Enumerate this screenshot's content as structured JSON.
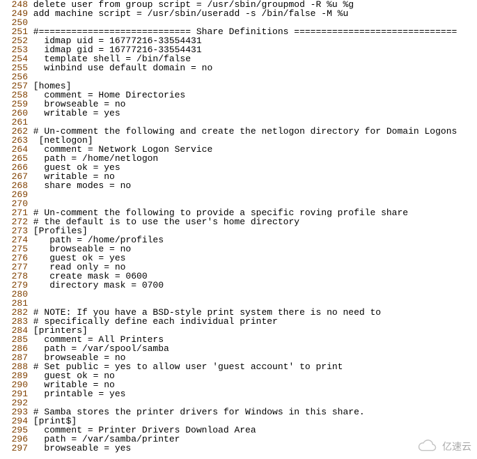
{
  "watermark": "亿速云",
  "lines": [
    {
      "n": 248,
      "t": " delete user from group script = /usr/sbin/groupmod -R %u %g"
    },
    {
      "n": 249,
      "t": " add machine script = /usr/sbin/useradd -s /bin/false -M %u"
    },
    {
      "n": 250,
      "t": ""
    },
    {
      "n": 251,
      "t": " #============================ Share Definitions =============================="
    },
    {
      "n": 252,
      "t": "   idmap uid = 16777216-33554431"
    },
    {
      "n": 253,
      "t": "   idmap gid = 16777216-33554431"
    },
    {
      "n": 254,
      "t": "   template shell = /bin/false"
    },
    {
      "n": 255,
      "t": "   winbind use default domain = no"
    },
    {
      "n": 256,
      "t": ""
    },
    {
      "n": 257,
      "t": " [homes]"
    },
    {
      "n": 258,
      "t": "   comment = Home Directories"
    },
    {
      "n": 259,
      "t": "   browseable = no"
    },
    {
      "n": 260,
      "t": "   writable = yes"
    },
    {
      "n": 261,
      "t": ""
    },
    {
      "n": 262,
      "t": " # Un-comment the following and create the netlogon directory for Domain Logons"
    },
    {
      "n": 263,
      "t": "  [netlogon]"
    },
    {
      "n": 264,
      "t": "   comment = Network Logon Service"
    },
    {
      "n": 265,
      "t": "   path = /home/netlogon"
    },
    {
      "n": 266,
      "t": "   guest ok = yes"
    },
    {
      "n": 267,
      "t": "   writable = no"
    },
    {
      "n": 268,
      "t": "   share modes = no"
    },
    {
      "n": 269,
      "t": ""
    },
    {
      "n": 270,
      "t": ""
    },
    {
      "n": 271,
      "t": " # Un-comment the following to provide a specific roving profile share"
    },
    {
      "n": 272,
      "t": " # the default is to use the user's home directory"
    },
    {
      "n": 273,
      "t": " [Profiles]"
    },
    {
      "n": 274,
      "t": "    path = /home/profiles"
    },
    {
      "n": 275,
      "t": "    browseable = no"
    },
    {
      "n": 276,
      "t": "    guest ok = yes"
    },
    {
      "n": 277,
      "t": "    read only = no"
    },
    {
      "n": 278,
      "t": "    create mask = 0600"
    },
    {
      "n": 279,
      "t": "    directory mask = 0700"
    },
    {
      "n": 280,
      "t": ""
    },
    {
      "n": 281,
      "t": ""
    },
    {
      "n": 282,
      "t": " # NOTE: If you have a BSD-style print system there is no need to"
    },
    {
      "n": 283,
      "t": " # specifically define each individual printer"
    },
    {
      "n": 284,
      "t": " [printers]"
    },
    {
      "n": 285,
      "t": "   comment = All Printers"
    },
    {
      "n": 286,
      "t": "   path = /var/spool/samba"
    },
    {
      "n": 287,
      "t": "   browseable = no"
    },
    {
      "n": 288,
      "t": " # Set public = yes to allow user 'guest account' to print"
    },
    {
      "n": 289,
      "t": "   guest ok = no"
    },
    {
      "n": 290,
      "t": "   writable = no"
    },
    {
      "n": 291,
      "t": "   printable = yes"
    },
    {
      "n": 292,
      "t": ""
    },
    {
      "n": 293,
      "t": " # Samba stores the printer drivers for Windows in this share."
    },
    {
      "n": 294,
      "t": " [print$]"
    },
    {
      "n": 295,
      "t": "   comment = Printer Drivers Download Area"
    },
    {
      "n": 296,
      "t": "   path = /var/samba/printer"
    },
    {
      "n": 297,
      "t": "   browseable = yes"
    }
  ]
}
